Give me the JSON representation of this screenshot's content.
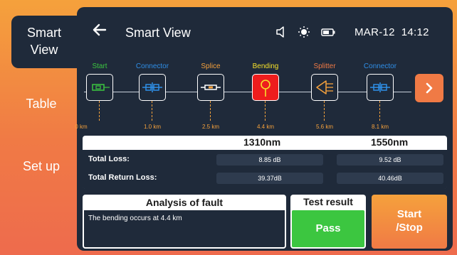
{
  "nav": {
    "tabs": [
      {
        "line1": "Smart",
        "line2": "View",
        "active": true
      },
      {
        "line1": "Table",
        "line2": "",
        "active": false
      },
      {
        "line1": "Set up",
        "line2": "",
        "active": false
      }
    ]
  },
  "header": {
    "back_icon": "arrow-left-icon",
    "title": "Smart View",
    "icons": [
      "speaker-icon",
      "brightness-icon",
      "battery-icon"
    ],
    "datetime": "MAR-12  14:12"
  },
  "trace": {
    "events": [
      {
        "label": "Start",
        "label_color": "#3cc640",
        "icon": "start-icon",
        "distance": "0 km",
        "fault": false
      },
      {
        "label": "Connector",
        "label_color": "#2f8fe8",
        "icon": "connector-icon",
        "distance": "1.0 km",
        "fault": false
      },
      {
        "label": "Splice",
        "label_color": "#f5a13c",
        "icon": "splice-icon",
        "distance": "2.5 km",
        "fault": false
      },
      {
        "label": "Bending",
        "label_color": "#f5e02a",
        "icon": "bending-icon",
        "distance": "4.4 km",
        "fault": true
      },
      {
        "label": "Splitter",
        "label_color": "#f07a45",
        "icon": "splitter-icon",
        "distance": "5.6 km",
        "fault": false
      },
      {
        "label": "Connector",
        "label_color": "#2f8fe8",
        "icon": "connector-icon",
        "distance": "8.1 km",
        "fault": false
      }
    ],
    "next_icon": "chevron-right-icon"
  },
  "loss": {
    "columns": [
      "1310nm",
      "1550nm"
    ],
    "rows": [
      {
        "label": "Total Loss:",
        "values": [
          "8.85 dB",
          "9.52 dB"
        ]
      },
      {
        "label": "Total Return Loss:",
        "values": [
          "39.37dB",
          "40.46dB"
        ]
      }
    ]
  },
  "fault": {
    "title": "Analysis of fault",
    "text": "The bending occurs at 4.4 km"
  },
  "result": {
    "title": "Test result",
    "status": "Pass",
    "status_color": "#3cc640"
  },
  "action": {
    "line1": "Start",
    "line2": "/Stop"
  },
  "colors": {
    "accent": "#f07a45",
    "panel": "#1f2a3a",
    "fault": "#ee1d1d"
  }
}
